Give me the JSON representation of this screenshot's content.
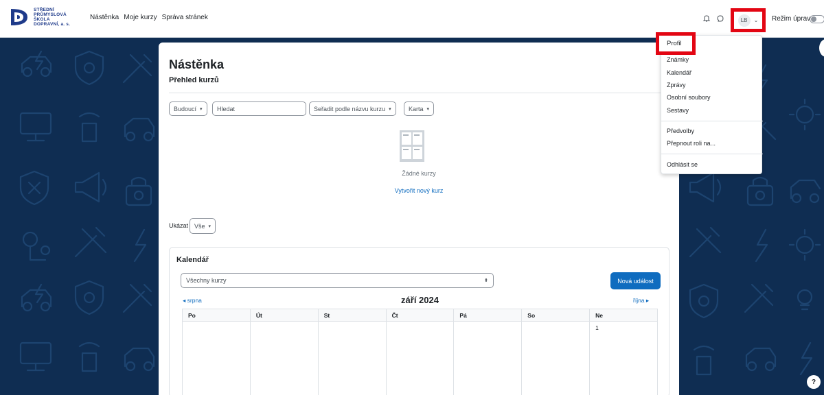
{
  "brand": {
    "logo_lines": [
      "STŘEDNÍ",
      "PRŮMYSLOVÁ",
      "ŠKOLA",
      "DOPRAVNÍ, a. s."
    ]
  },
  "nav": {
    "items": [
      "Nástěnka",
      "Moje kurzy",
      "Správa stránek"
    ],
    "user_initials": "LB",
    "edit_mode_label": "Režim úprav"
  },
  "user_menu": {
    "items": [
      "Profil",
      "Známky",
      "Kalendář",
      "Zprávy",
      "Osobní soubory",
      "Sestavy"
    ],
    "group2": [
      "Předvolby",
      "Přepnout roli na..."
    ],
    "logout": "Odhlásit se"
  },
  "page": {
    "title": "Nástěnka",
    "section": "Přehled kurzů"
  },
  "filters": {
    "timeline": "Budoucí",
    "search_placeholder": "Hledat",
    "sort": "Seřadit podle názvu kurzu",
    "view": "Karta"
  },
  "courses": {
    "empty_text": "Žádné kurzy",
    "create_link": "Vytvořit nový kurz"
  },
  "paging": {
    "show_label": "Ukázat",
    "show_value": "Vše"
  },
  "calendar": {
    "title": "Kalendář",
    "course_filter": "Všechny kurzy",
    "new_event": "Nová událost",
    "prev_month": "srpna",
    "month": "září 2024",
    "next_month": "října",
    "weekdays": [
      "Po",
      "Út",
      "St",
      "Čt",
      "Pá",
      "So",
      "Ne"
    ],
    "first_day": "1"
  },
  "colors": {
    "brand_blue": "#0f6cbf",
    "highlight_red": "#e30613",
    "background": "#0f2d52"
  }
}
